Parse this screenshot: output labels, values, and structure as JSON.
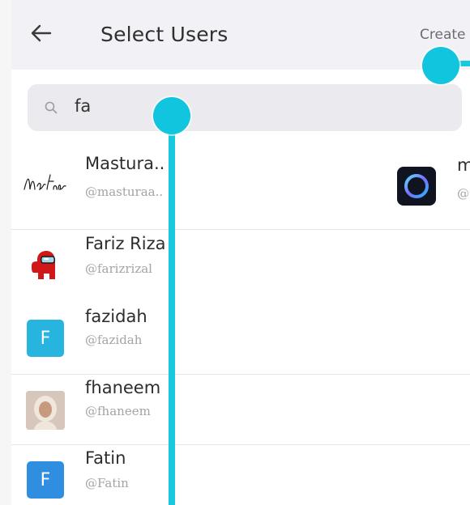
{
  "header": {
    "title": "Select Users",
    "create_label": "Create"
  },
  "search": {
    "value": "fa",
    "placeholder": ""
  },
  "users": [
    {
      "name": "Mastura..",
      "handle": "@masturaa..",
      "avatar": "signature-logo"
    },
    {
      "name": "Fariz Riza",
      "handle": "@farizrizal",
      "avatar": "red-character"
    },
    {
      "name": "fazidah",
      "handle": "@fazidah",
      "avatar_letter": "F",
      "avatar_color": "#27b5e0"
    },
    {
      "name": "fhaneem",
      "handle": "@fhaneem",
      "avatar": "photo"
    },
    {
      "name": "Fatin",
      "handle": "@Fatin",
      "avatar_letter": "F",
      "avatar_color": "#2f8ee0"
    }
  ],
  "right_user": {
    "name": "m",
    "handle": "@"
  },
  "colors": {
    "header_bg": "#f2f1f6",
    "search_bg": "#ebeaef",
    "annotation": "#10c5dd"
  }
}
